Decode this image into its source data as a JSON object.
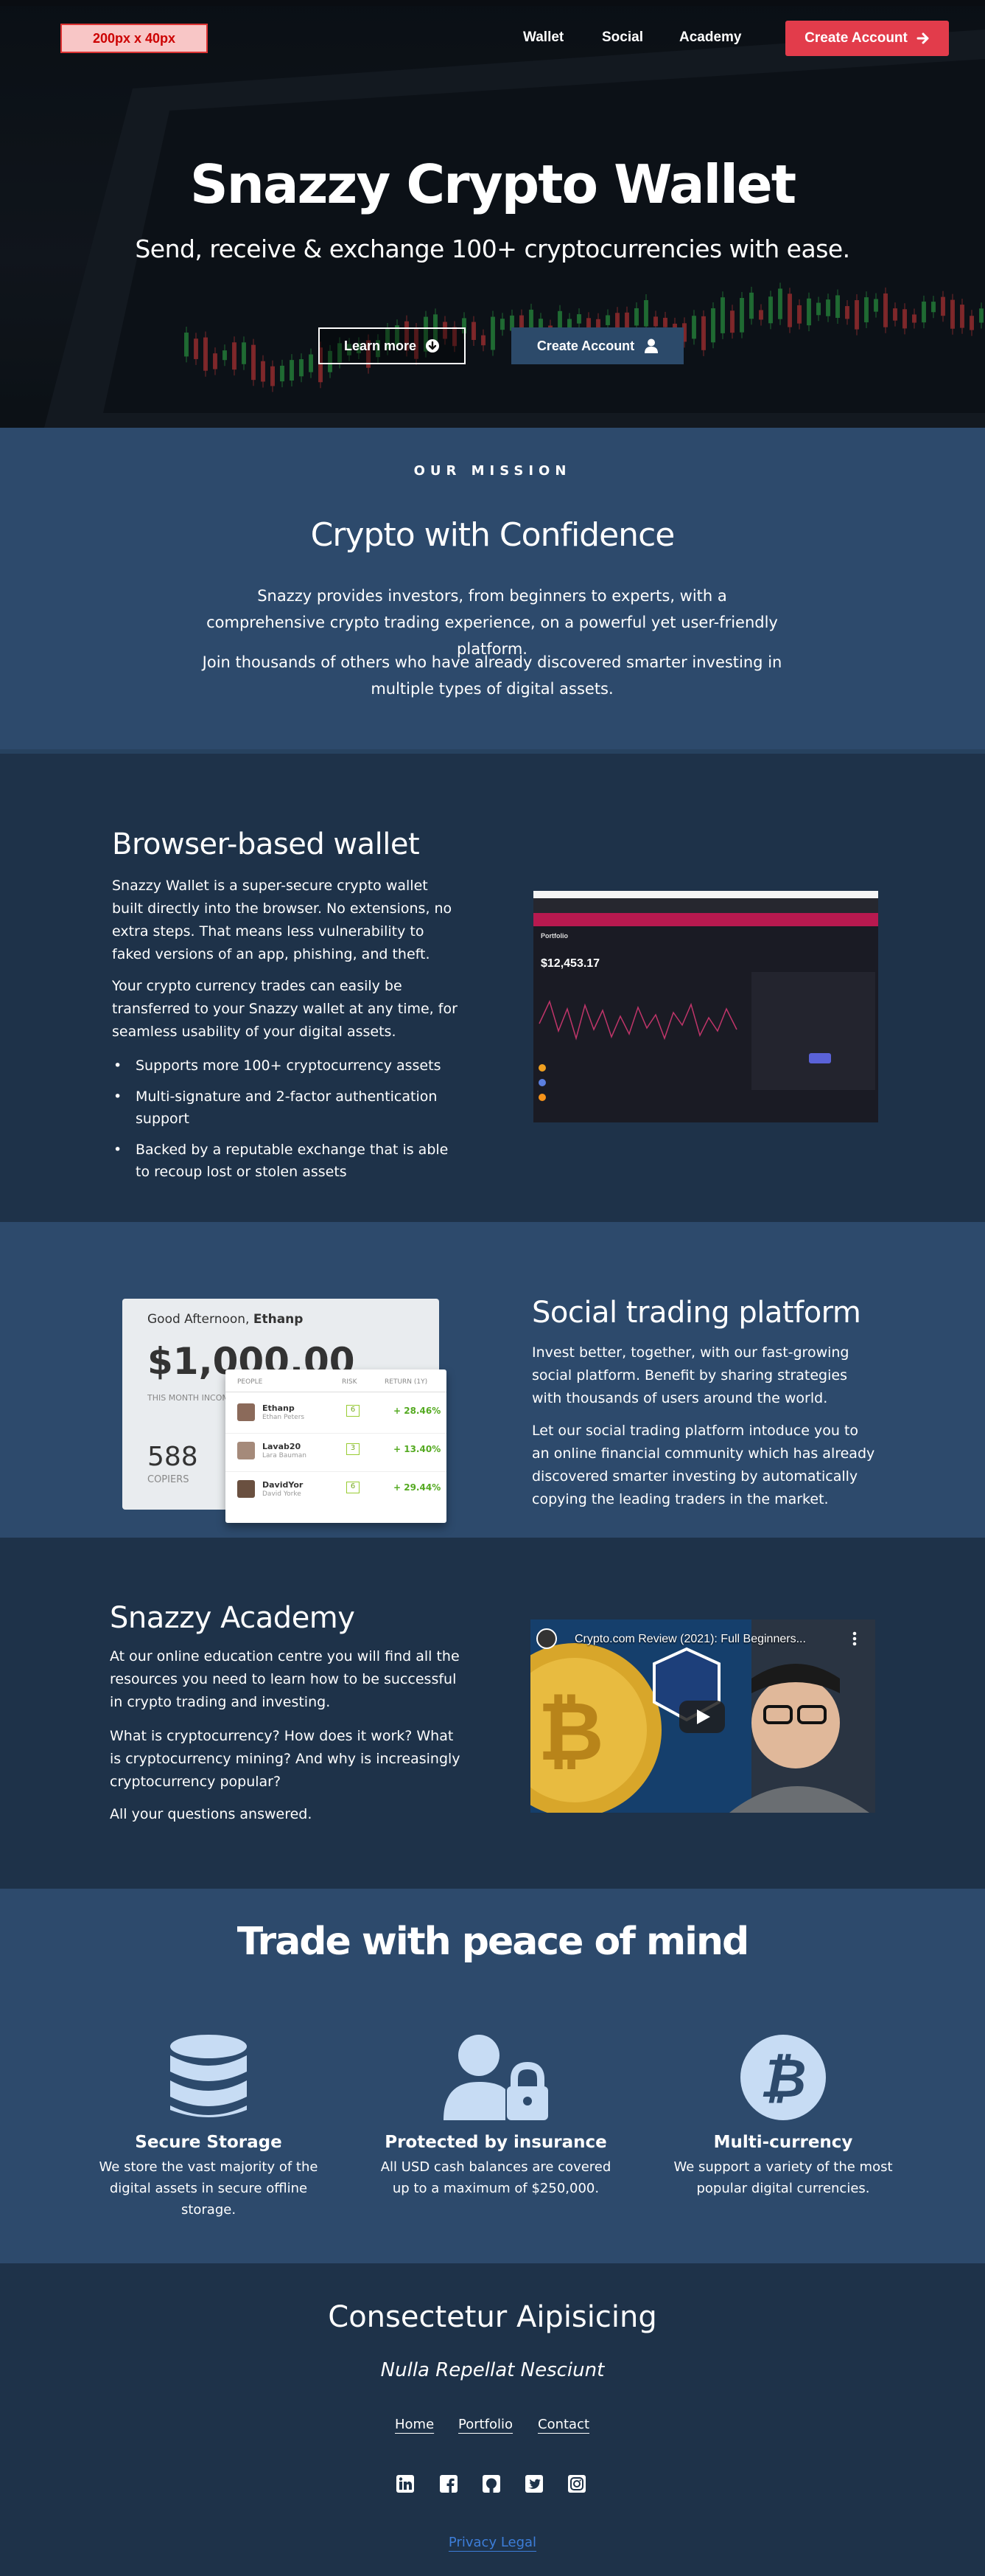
{
  "header": {
    "logo_placeholder": "200px x 40px",
    "nav": [
      "Wallet",
      "Social",
      "Academy"
    ],
    "cta_label": "Create Account"
  },
  "hero": {
    "title": "Snazzy Crypto Wallet",
    "subtitle": "Send, receive & exchange 100+ cryptocurrencies with ease.",
    "learn_more": "Learn more",
    "create_account": "Create Account"
  },
  "mission": {
    "eyebrow": "OUR MISSION",
    "title": "Crypto with Confidence",
    "p1": "Snazzy provides investors, from beginners to experts, with a comprehensive crypto trading experience, on a powerful yet user-friendly platform.",
    "p2": "Join thousands of others who have already discovered smarter investing in multiple types of digital assets."
  },
  "wallet": {
    "title": "Browser-based wallet",
    "p1": "Snazzy Wallet is a super-secure crypto wallet built directly into the browser. No extensions, no extra steps. That means less vulnerability to faked versions of an app, phishing, and theft.",
    "p2": "Your crypto currency trades can easily be transferred to your Snazzy wallet at any time, for seamless usability of your digital assets.",
    "bullets": [
      "Supports more 100+ cryptocurrency assets",
      "Multi-signature and 2-factor authentication support",
      "Backed by a reputable exchange that is able to recoup lost or stolen assets"
    ],
    "screenshot": {
      "balance": "$12,453.17",
      "tab": "Portfolio"
    }
  },
  "social": {
    "title": "Social trading platform",
    "p1": "Invest better, together, with our fast-growing social platform. Benefit by sharing strategies with thousands of users around the world.",
    "p2": "Let our social trading platform intoduce you to an online financial community which has already discovered smarter investing by automatically copying the leading traders in the market.",
    "card": {
      "greeting": "Good Afternoon,",
      "name": "Ethanp",
      "amount": "$1,000.00",
      "amount_label": "THIS MONTH INCOME",
      "copiers": "588",
      "copiers_label": "COPIERS",
      "col_people": "PEOPLE",
      "col_risk": "RISK",
      "col_return": "RETURN (1Y)",
      "rows": [
        {
          "name": "Ethanp",
          "sub": "Ethan Peters",
          "risk": "6",
          "ret": "+ 28.46%"
        },
        {
          "name": "Lavab20",
          "sub": "Lara Bauman",
          "risk": "3",
          "ret": "+ 13.40%"
        },
        {
          "name": "DavidYor",
          "sub": "David Yorke",
          "risk": "6",
          "ret": "+ 29.44%"
        }
      ]
    }
  },
  "academy": {
    "title": "Snazzy Academy",
    "p1": "At our online education centre you will find all the resources you need to learn how to be successful in crypto trading and investing.",
    "p2": "What is cryptocurrency? How does it work? What is cryptocurrency mining? And why is increasingly cryptocurrency popular?",
    "p3": "All your questions answered.",
    "video_title": "Crypto.com Review (2021): Full Beginners..."
  },
  "trade": {
    "title": "Trade with peace of mind",
    "features": [
      {
        "icon": "database-icon",
        "title": "Secure Storage",
        "desc": "We store the vast majority of the digital assets in secure offline storage."
      },
      {
        "icon": "user-lock-icon",
        "title": "Protected by insurance",
        "desc": "All USD cash balances are covered up to a maximum of $250,000."
      },
      {
        "icon": "bitcoin-icon",
        "title": "Multi-currency",
        "desc": "We support a variety of the most popular digital currencies."
      }
    ]
  },
  "footer": {
    "title": "Consectetur Aipisicing",
    "tagline": "Nulla Repellat Nesciunt",
    "links": [
      "Home",
      "Portfolio",
      "Contact"
    ],
    "social_icons": [
      "linkedin-icon",
      "facebook-icon",
      "github-icon",
      "twitter-icon",
      "instagram-icon"
    ],
    "privacy": "Privacy Legal"
  },
  "colors": {
    "accent_red": "#e23c4b",
    "section_light": "#2d4a6c",
    "section_dark": "#1e3249",
    "icon_blue": "#c7dcf4"
  }
}
